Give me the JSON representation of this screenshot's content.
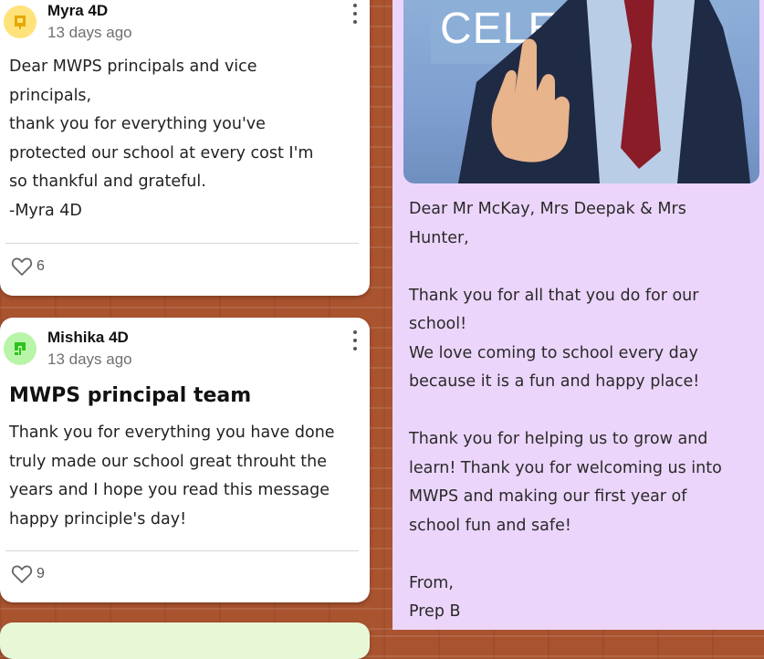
{
  "posts": [
    {
      "author": "Myra 4D",
      "time": "13 days ago",
      "body": "Dear MWPS principals and vice\nprincipals,\nthank you for everything you've\nprotected our school at every cost I'm\nso thankful and grateful.\n-Myra 4D",
      "likes": "6"
    },
    {
      "author": "Mishika 4D",
      "time": "13 days ago",
      "title": "MWPS principal team",
      "body": "Thank you for everything you have done\ntruly made our school great throuht the\nyears and I hope you read this message\nhappy principle's day!",
      "likes": "9"
    }
  ],
  "feature_note": {
    "image_text": "CELEBRATE",
    "body": "Dear Mr McKay, Mrs Deepak & Mrs\nHunter,\n\nThank you for all that you do for our\nschool!\nWe love coming to school every day\nbecause it is a fun and happy place!\n\nThank you for helping us to grow and\nlearn! Thank you for welcoming us into\nMWPS and making our first year of\nschool fun and safe!\n\nFrom,\nPrep B"
  },
  "colors": {
    "wall": "#a9532f",
    "card": "#ffffff",
    "note_background": "#ecd5fb",
    "next_card": "#e8f8d7"
  },
  "icons": [
    "user-avatar-icon",
    "kebab-menu-icon",
    "heart-icon"
  ]
}
